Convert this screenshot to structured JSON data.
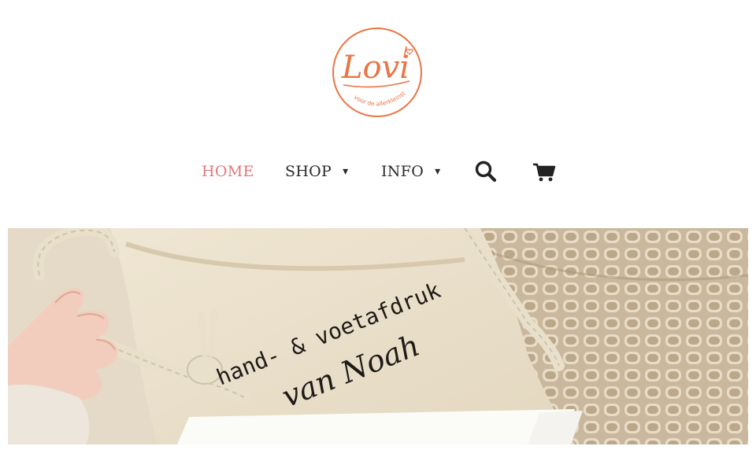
{
  "brand": {
    "logo_text": "Lovi",
    "tagline": "voor de allerkleinste",
    "color": "#ea7444"
  },
  "nav": {
    "items": [
      {
        "label": "HOME",
        "active": true
      },
      {
        "label": "SHOP",
        "dropdown": true
      },
      {
        "label": "INFO",
        "dropdown": true
      }
    ],
    "caret": "▾",
    "active_color": "#e2787a",
    "search_icon": "search-icon",
    "cart_icon": "cart-icon"
  },
  "hero": {
    "bag_text_line1": "hand- & voetafdruk",
    "bag_text_line2": "van Noah"
  }
}
